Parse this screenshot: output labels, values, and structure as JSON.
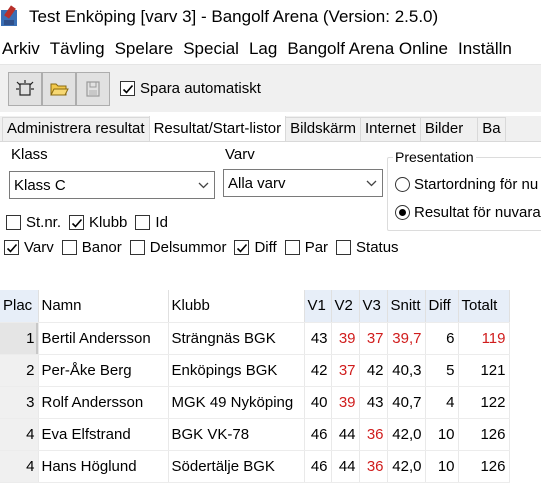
{
  "window": {
    "title": "Test Enköping [varv 3] - Bangolf Arena (Version: 2.5.0)"
  },
  "menu": [
    "Arkiv",
    "Tävling",
    "Spelare",
    "Special",
    "Lag",
    "Bangolf Arena Online",
    "Inställn"
  ],
  "toolbar": {
    "autosave_label": "Spara automatiskt",
    "autosave_checked": true
  },
  "tabs": [
    "Administrera resultat",
    "Resultat/Start-listor",
    "Bildskärm",
    "Internet",
    "Bilder",
    "Ba"
  ],
  "active_tab": 1,
  "filters": {
    "klass_label": "Klass",
    "klass_value": "Klass C",
    "varv_label": "Varv",
    "varv_value": "Alla varv"
  },
  "presentation": {
    "legend": "Presentation",
    "options": [
      "Startordning för nu",
      "Resultat för nuvara"
    ],
    "selected": 1
  },
  "columns_row1": [
    {
      "label": "St.nr.",
      "checked": false
    },
    {
      "label": "Klubb",
      "checked": true
    },
    {
      "label": "Id",
      "checked": false
    }
  ],
  "columns_row2": [
    {
      "label": "Varv",
      "checked": true
    },
    {
      "label": "Banor",
      "checked": false
    },
    {
      "label": "Delsummor",
      "checked": false
    },
    {
      "label": "Diff",
      "checked": true
    },
    {
      "label": "Par",
      "checked": false
    },
    {
      "label": "Status",
      "checked": false
    }
  ],
  "table": {
    "headers": [
      "Plac",
      "Namn",
      "Klubb",
      "V1",
      "V2",
      "V3",
      "Snitt",
      "Diff",
      "Totalt"
    ],
    "rows": [
      {
        "plac": "1",
        "namn": "Bertil Andersson",
        "klubb": "Strängnäs BGK",
        "v1": "43",
        "v2": "39",
        "v3": "37",
        "snitt": "39,7",
        "diff": "6",
        "totalt": "119",
        "red": [
          "v2",
          "v3",
          "snitt",
          "totalt"
        ]
      },
      {
        "plac": "2",
        "namn": "Per-Åke Berg",
        "klubb": "Enköpings BGK",
        "v1": "42",
        "v2": "37",
        "v3": "42",
        "snitt": "40,3",
        "diff": "5",
        "totalt": "121",
        "red": [
          "v2"
        ]
      },
      {
        "plac": "3",
        "namn": "Rolf Andersson",
        "klubb": "MGK 49 Nyköping",
        "v1": "40",
        "v2": "39",
        "v3": "43",
        "snitt": "40,7",
        "diff": "4",
        "totalt": "122",
        "red": [
          "v2"
        ]
      },
      {
        "plac": "4",
        "namn": "Eva Elfstrand",
        "klubb": "BGK VK-78",
        "v1": "46",
        "v2": "44",
        "v3": "36",
        "snitt": "42,0",
        "diff": "10",
        "totalt": "126",
        "red": [
          "v3"
        ]
      },
      {
        "plac": "4",
        "namn": "Hans Höglund",
        "klubb": "Södertälje BGK",
        "v1": "46",
        "v2": "44",
        "v3": "36",
        "snitt": "42,0",
        "diff": "10",
        "totalt": "126",
        "red": [
          "v3"
        ]
      }
    ]
  },
  "colors": {
    "highlight_red": "#d01c1c",
    "header_highlight": "#e7eef8"
  },
  "icons": [
    "app-icon",
    "new-icon",
    "open-folder-icon",
    "save-disk-icon",
    "checkmark-icon",
    "chevron-down-icon"
  ]
}
